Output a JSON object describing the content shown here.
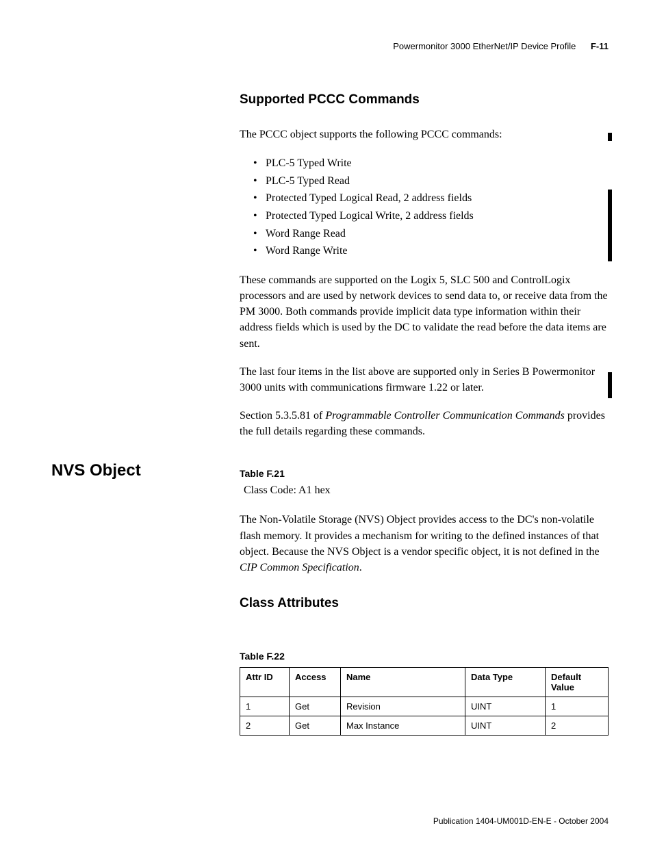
{
  "header": {
    "title": "Powermonitor 3000 EtherNet/IP Device Profile",
    "pagenum": "F-11"
  },
  "sec1": {
    "heading": "Supported PCCC Commands",
    "intro": "The PCCC object supports the following PCCC commands:",
    "items": [
      "PLC-5 Typed Write",
      "PLC-5 Typed Read",
      "Protected Typed Logical Read, 2 address fields",
      "Protected Typed Logical Write, 2 address fields",
      "Word Range Read",
      "Word Range Write"
    ],
    "para2": "These commands are supported on the Logix 5, SLC 500 and ControlLogix processors and are used by network devices to send data to, or receive data from the PM 3000. Both commands provide implicit data type information within their address fields which is used by the DC to validate the read before the data items are sent.",
    "para3": "The last four items in the list above are supported only in Series B Powermonitor 3000 units with communications firmware 1.22 or later.",
    "para4a": "Section 5.3.5.81 of ",
    "para4b": "Programmable Controller Communication Commands",
    "para4c": " provides the full details regarding these commands."
  },
  "side_heading": "NVS Object",
  "sec2": {
    "table_caption": "Table F.21",
    "class_code": "Class Code: A1 hex",
    "para_a": "The Non-Volatile Storage (NVS) Object provides access to the DC's non-volatile flash memory. It provides a mechanism for writing to the defined instances of that object.  Because the NVS Object is a vendor specific object, it is not defined in the ",
    "para_b": "CIP Common Specification",
    "para_c": "."
  },
  "sec3": {
    "heading": "Class Attributes",
    "table_caption": "Table F.22",
    "headers": [
      "Attr ID",
      "Access",
      "Name",
      "Data Type",
      "Default Value"
    ],
    "rows": [
      [
        "1",
        "Get",
        "Revision",
        "UINT",
        "1"
      ],
      [
        "2",
        "Get",
        "Max Instance",
        "UINT",
        "2"
      ]
    ]
  },
  "footer": "Publication 1404-UM001D-EN-E - October 2004"
}
